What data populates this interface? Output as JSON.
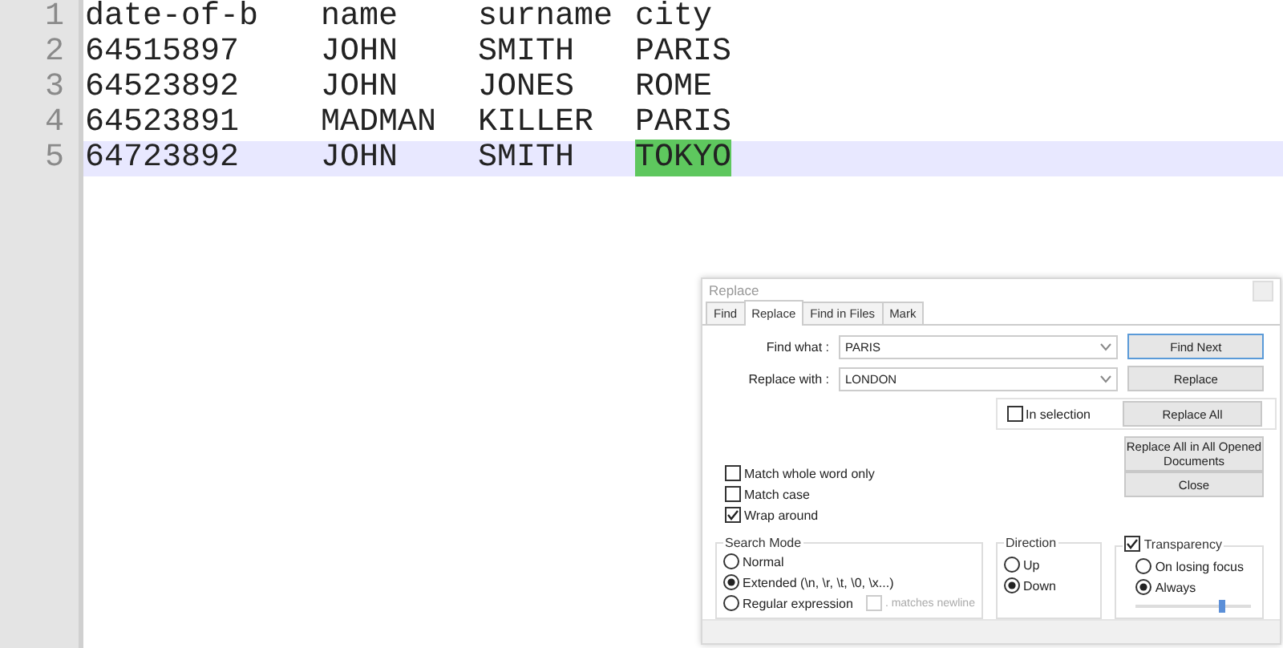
{
  "editor": {
    "lines": [
      {
        "number": "1",
        "current": false,
        "cells": [
          {
            "text": "date-of-b",
            "selected": false
          },
          {
            "text": "name",
            "selected": false
          },
          {
            "text": "surname",
            "selected": false
          },
          {
            "text": "city",
            "selected": false
          }
        ]
      },
      {
        "number": "2",
        "current": false,
        "cells": [
          {
            "text": "64515897",
            "selected": false
          },
          {
            "text": "JOHN",
            "selected": false
          },
          {
            "text": "SMITH",
            "selected": false
          },
          {
            "text": "PARIS",
            "selected": false
          }
        ]
      },
      {
        "number": "3",
        "current": false,
        "cells": [
          {
            "text": "64523892",
            "selected": false
          },
          {
            "text": "JOHN",
            "selected": false
          },
          {
            "text": "JONES",
            "selected": false
          },
          {
            "text": "ROME",
            "selected": false
          }
        ]
      },
      {
        "number": "4",
        "current": false,
        "cells": [
          {
            "text": "64523891",
            "selected": false
          },
          {
            "text": "MADMAN",
            "selected": false
          },
          {
            "text": "KILLER",
            "selected": false
          },
          {
            "text": "PARIS",
            "selected": false
          }
        ]
      },
      {
        "number": "5",
        "current": true,
        "cells": [
          {
            "text": "64723892",
            "selected": false
          },
          {
            "text": "JOHN",
            "selected": false
          },
          {
            "text": "SMITH",
            "selected": false
          },
          {
            "text": "TOKYO",
            "selected": true
          }
        ]
      }
    ]
  },
  "dialog": {
    "title": "Replace",
    "tabs": [
      {
        "label": "Find",
        "selected": false
      },
      {
        "label": "Replace",
        "selected": true
      },
      {
        "label": "Find in Files",
        "selected": false
      },
      {
        "label": "Mark",
        "selected": false
      }
    ],
    "find_what": {
      "label": "Find what :",
      "value": "PARIS"
    },
    "replace_with": {
      "label": "Replace with :",
      "value": "LONDON"
    },
    "buttons": [
      "Find Next",
      "Replace",
      "Replace All",
      "Replace All in All Opened Documents",
      "Close"
    ],
    "in_selection": {
      "label": "In selection",
      "checked": false
    },
    "options": [
      {
        "label": "Match whole word only",
        "checked": false
      },
      {
        "label": "Match case",
        "checked": false
      },
      {
        "label": "Wrap around",
        "checked": true
      }
    ],
    "search_mode": {
      "title": "Search Mode",
      "options": [
        {
          "label": "Normal",
          "selected": false
        },
        {
          "label": "Extended (\\n, \\r, \\t, \\0, \\x...)",
          "selected": true
        },
        {
          "label": "Regular expression",
          "selected": false
        }
      ],
      "dot_newline": {
        "label": ". matches newline",
        "checked": false,
        "disabled": true
      }
    },
    "direction": {
      "title": "Direction",
      "options": [
        {
          "label": "Up",
          "selected": false
        },
        {
          "label": "Down",
          "selected": true
        }
      ]
    },
    "transparency": {
      "label": "Transparency",
      "checked": true,
      "options": [
        {
          "label": "On losing focus",
          "selected": false
        },
        {
          "label": "Always",
          "selected": true
        }
      ],
      "level": 0.75
    }
  }
}
